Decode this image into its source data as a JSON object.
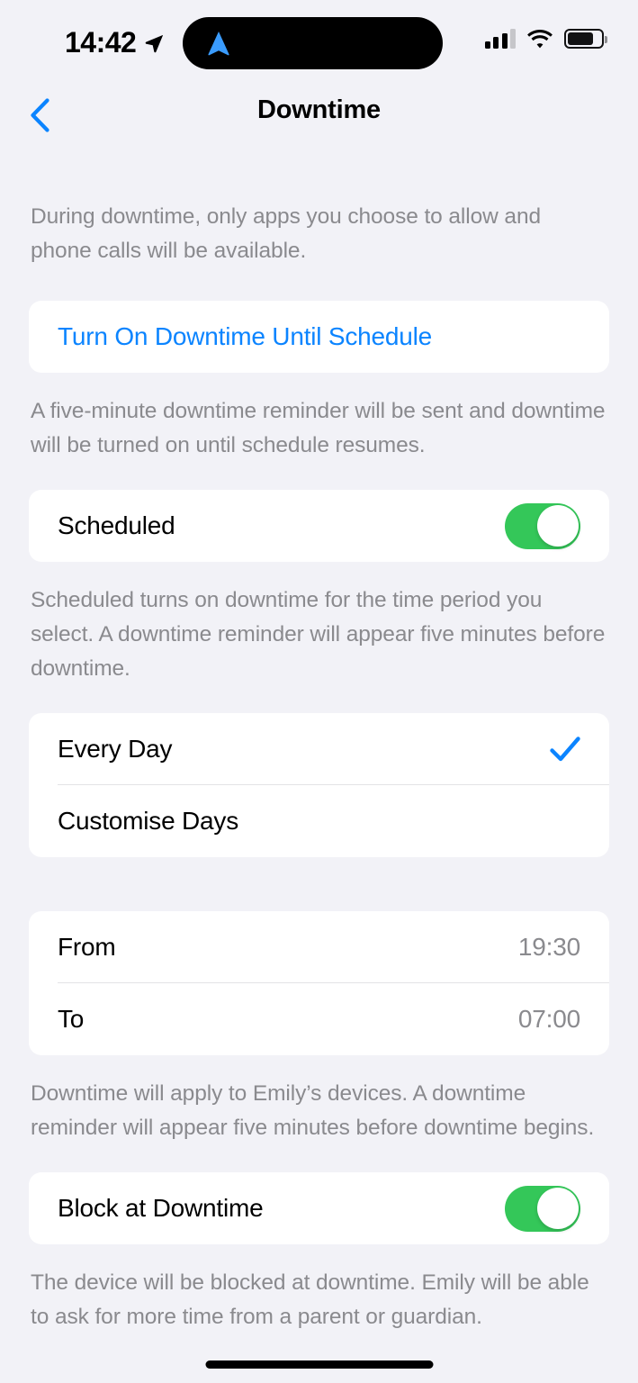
{
  "status_bar": {
    "time": "14:42",
    "location_icon": "location-arrow-icon",
    "dynamic_island_icon": "navigation-arrow-icon",
    "signal_icon": "cellular-signal-icon",
    "wifi_icon": "wifi-icon",
    "battery_icon": "battery-icon",
    "accent_blue": "#0B84FF"
  },
  "nav": {
    "back_icon": "chevron-left-icon",
    "title": "Downtime"
  },
  "intro_footer": "During downtime, only apps you choose to allow and phone calls will be available.",
  "turn_on": {
    "label": "Turn On Downtime Until Schedule",
    "footer": "A five-minute downtime reminder will be sent and downtime will be turned on until schedule resumes."
  },
  "scheduled": {
    "label": "Scheduled",
    "toggle_state": "on",
    "toggle_color": "#34C759",
    "footer": "Scheduled turns on downtime for the time period you select. A downtime reminder will appear five minutes before downtime."
  },
  "days": {
    "options": [
      {
        "label": "Every Day",
        "selected": true,
        "check_icon": "checkmark-icon"
      },
      {
        "label": "Customise Days",
        "selected": false
      }
    ]
  },
  "schedule_times": {
    "rows": [
      {
        "label": "From",
        "value": "19:30"
      },
      {
        "label": "To",
        "value": "07:00"
      }
    ],
    "footer": "Downtime will apply to Emily’s devices. A downtime reminder will appear five minutes before downtime begins."
  },
  "block_at_downtime": {
    "label": "Block at Downtime",
    "toggle_state": "on",
    "toggle_color": "#34C759",
    "footer": "The device will be blocked at downtime. Emily will be able to ask for more time from a parent or guardian."
  },
  "home_indicator": "home-indicator"
}
